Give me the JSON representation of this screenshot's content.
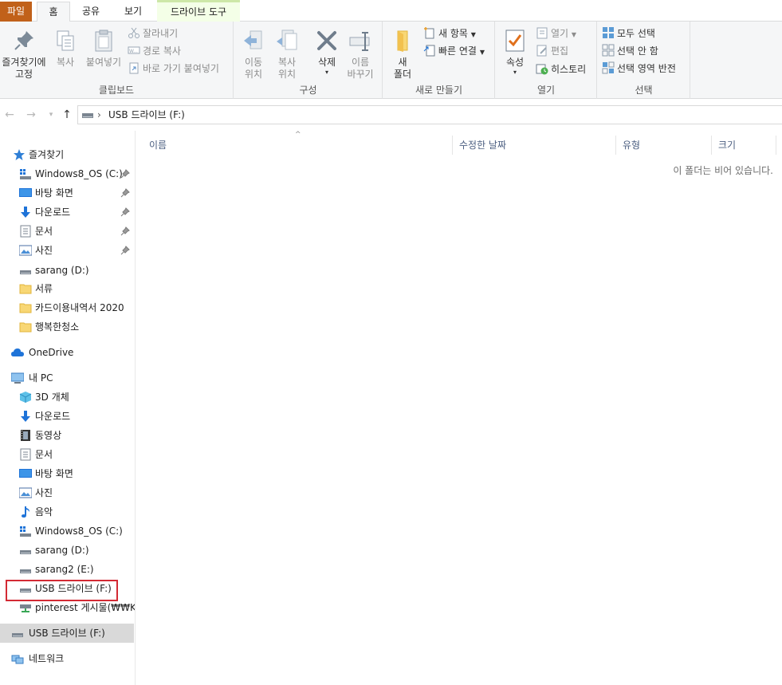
{
  "ribbon_tabs": {
    "file": "파일",
    "home": "홈",
    "share": "공유",
    "view": "보기",
    "drive_tools": "드라이브 도구"
  },
  "clipboard": {
    "pin_label_1": "즐겨찾기에",
    "pin_label_2": "고정",
    "copy": "복사",
    "paste": "붙여넣기",
    "cut": "잘라내기",
    "copy_path": "경로 복사",
    "paste_shortcut": "바로 가기 붙여넣기",
    "group_label": "클립보드"
  },
  "organize": {
    "move_to_1": "이동",
    "move_to_2": "위치",
    "copy_to_1": "복사",
    "copy_to_2": "위치",
    "delete": "삭제",
    "rename_1": "이름",
    "rename_2": "바꾸기",
    "group_label": "구성"
  },
  "new": {
    "folder_1": "새",
    "folder_2": "폴더",
    "new_item": "새 항목",
    "easy_access": "빠른 연결",
    "group_label": "새로 만들기"
  },
  "open": {
    "properties": "속성",
    "open": "열기",
    "edit": "편집",
    "history": "히스토리",
    "group_label": "열기"
  },
  "select": {
    "select_all": "모두 선택",
    "select_none": "선택 안 함",
    "invert": "선택 영역 반전",
    "group_label": "선택"
  },
  "address": {
    "crumb": "USB 드라이브 (F:)",
    "separator": "›"
  },
  "sidebar": {
    "quick_access": "즐겨찾기",
    "quick_items": [
      "Windows8_OS (C:)",
      "바탕 화면",
      "다운로드",
      "문서",
      "사진",
      "sarang (D:)",
      "서류",
      "카드이용내역서 2020",
      "행복한청소"
    ],
    "onedrive": "OneDrive",
    "this_pc": "내 PC",
    "pc_items": [
      "3D 개체",
      "다운로드",
      "동영상",
      "문서",
      "바탕 화면",
      "사진",
      "음악",
      "Windows8_OS (C:)",
      "sarang (D:)",
      "sarang2 (E:)",
      "USB 드라이브 (F:)",
      "pinterest 게시물(₩₩KIN"
    ],
    "usb_root": "USB 드라이브 (F:)",
    "network": "네트워크"
  },
  "columns": {
    "name": "이름",
    "modified": "수정한 날짜",
    "type": "유형",
    "size": "크기",
    "sort_caret": "^"
  },
  "empty_message": "이 폴더는 비어 있습니다.",
  "colors": {
    "file_tab": "#c1611a",
    "selection": "#d9d9d9",
    "highlight_box": "#d32a34",
    "folder": "#f8d775",
    "accent_blue": "#1e73d8"
  }
}
